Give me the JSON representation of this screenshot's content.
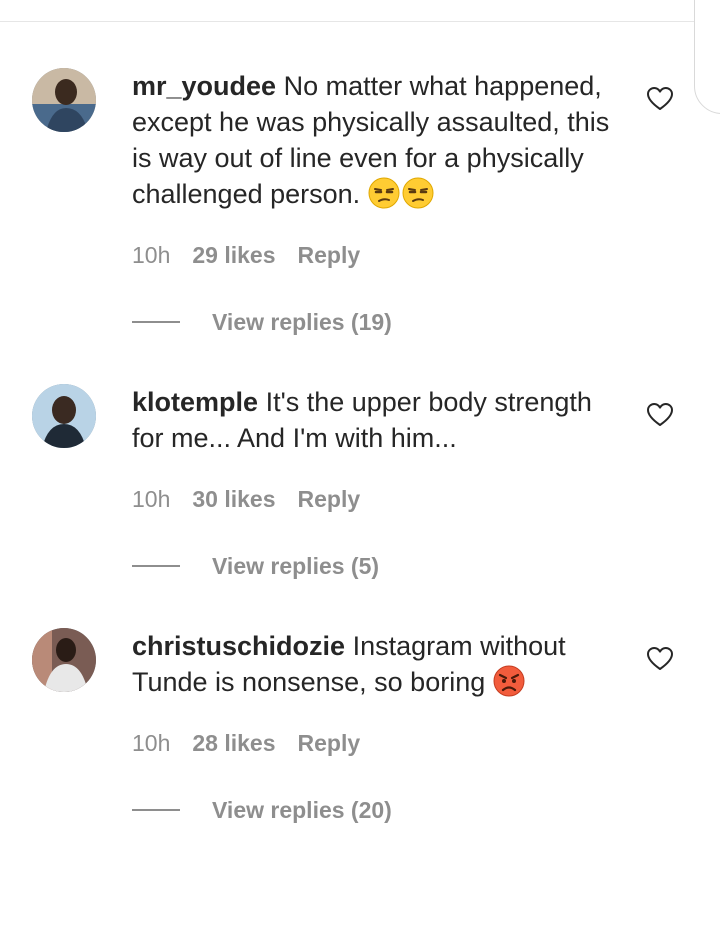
{
  "comments": [
    {
      "username": "mr_youdee",
      "text": "No matter what happened, except he was physically assaulted, this is way out of line even for a physically challenged person.",
      "emojis": [
        "unamused-face",
        "unamused-face"
      ],
      "time": "10h",
      "likes": "29 likes",
      "reply": "Reply",
      "view_replies": "View replies (19)"
    },
    {
      "username": "klotemple",
      "text": "It's the upper body strength for me... And I'm with him...",
      "emojis": [],
      "time": "10h",
      "likes": "30 likes",
      "reply": "Reply",
      "view_replies": "View replies (5)"
    },
    {
      "username": "christuschidozie",
      "text": "Instagram without Tunde is nonsense, so boring",
      "emojis": [
        "angry-face"
      ],
      "time": "10h",
      "likes": "28 likes",
      "reply": "Reply",
      "view_replies": "View replies (20)"
    }
  ]
}
